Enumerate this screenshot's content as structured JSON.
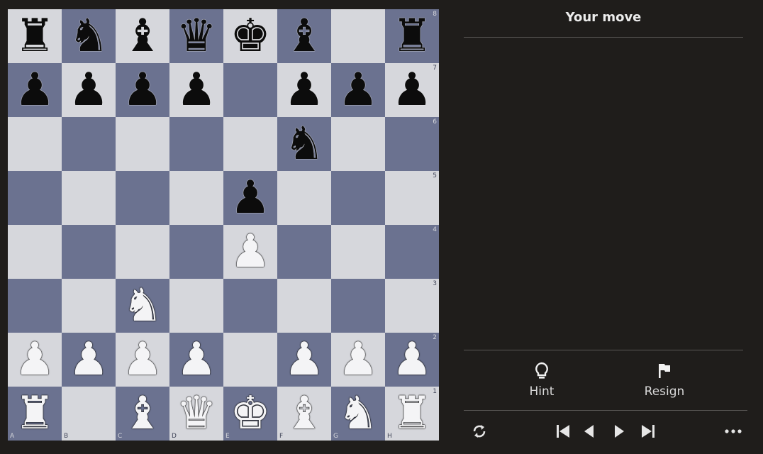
{
  "board": {
    "files": [
      "A",
      "B",
      "C",
      "D",
      "E",
      "F",
      "G",
      "H"
    ],
    "ranks": [
      "8",
      "7",
      "6",
      "5",
      "4",
      "3",
      "2",
      "1"
    ],
    "rows": [
      [
        "br",
        "bn",
        "bb",
        "bq",
        "bk",
        "bb",
        "",
        "br"
      ],
      [
        "bp",
        "bp",
        "bp",
        "bp",
        "",
        "bp",
        "bp",
        "bp"
      ],
      [
        "",
        "",
        "",
        "",
        "",
        "bn",
        "",
        ""
      ],
      [
        "",
        "",
        "",
        "",
        "bp",
        "",
        "",
        ""
      ],
      [
        "",
        "",
        "",
        "",
        "wp",
        "",
        "",
        ""
      ],
      [
        "",
        "",
        "wn",
        "",
        "",
        "",
        "",
        ""
      ],
      [
        "wp",
        "wp",
        "wp",
        "wp",
        "",
        "wp",
        "wp",
        "wp"
      ],
      [
        "wr",
        "",
        "wb",
        "wq",
        "wk",
        "wb",
        "wn",
        "wr"
      ]
    ],
    "colors": {
      "light": "#d6d7dc",
      "dark": "#6b7290"
    }
  },
  "panel": {
    "status": "Your move",
    "actions": {
      "hint_label": "Hint",
      "hint_icon": "lightbulb-icon",
      "resign_label": "Resign",
      "resign_icon": "flag-icon"
    },
    "navigation": {
      "flip_icon": "rotate-icon",
      "first_icon": "skip-back-icon",
      "prev_icon": "step-back-icon",
      "next_icon": "step-forward-icon",
      "last_icon": "skip-forward-icon",
      "more_icon": "more-dots-icon"
    }
  }
}
